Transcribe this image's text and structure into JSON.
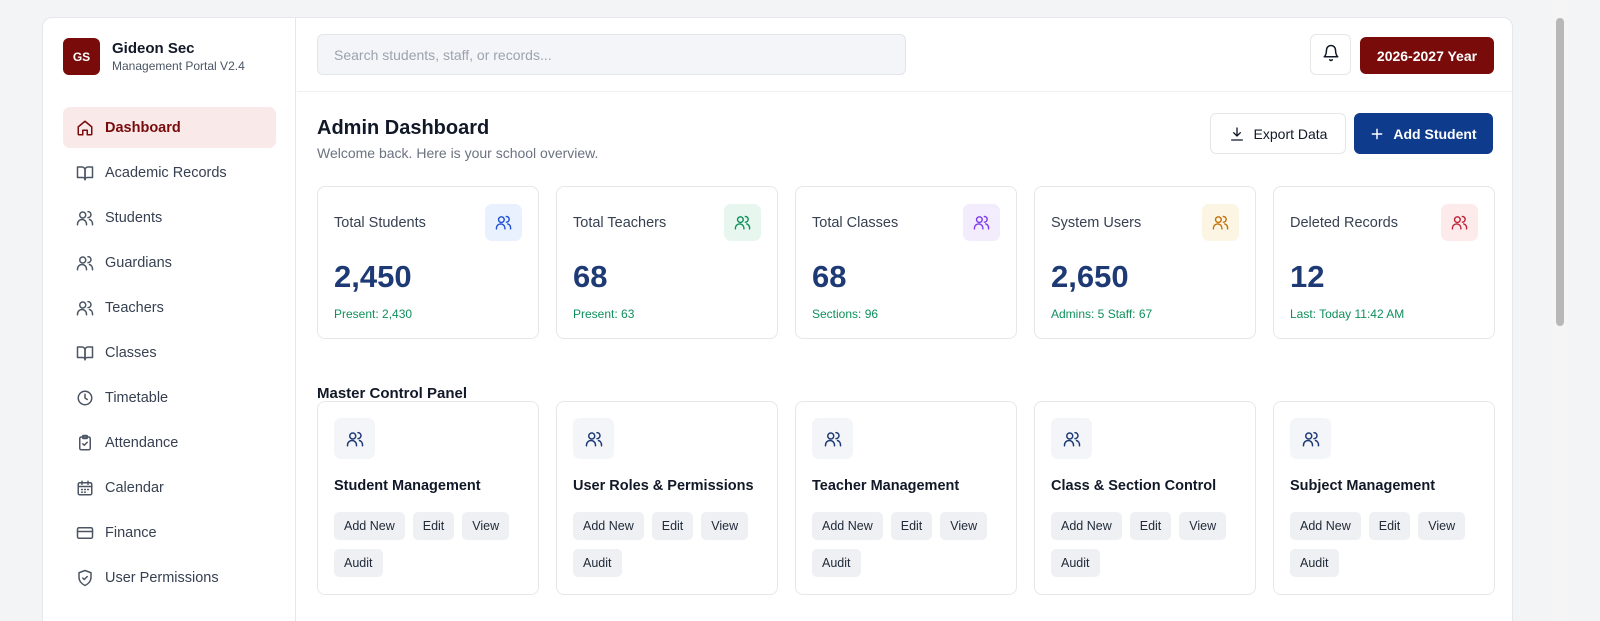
{
  "brand": {
    "logo_text": "GS",
    "name": "Gideon Sec",
    "subtitle": "Management Portal V2.4",
    "color": "#7a0b0b"
  },
  "sidebar": {
    "items": [
      {
        "label": "Dashboard",
        "icon": "home-icon",
        "active": true
      },
      {
        "label": "Academic Records",
        "icon": "book-icon"
      },
      {
        "label": "Students",
        "icon": "users-icon"
      },
      {
        "label": "Guardians",
        "icon": "users-icon"
      },
      {
        "label": "Teachers",
        "icon": "users-icon"
      },
      {
        "label": "Classes",
        "icon": "book-icon"
      },
      {
        "label": "Timetable",
        "icon": "clock-icon"
      },
      {
        "label": "Attendance",
        "icon": "clipboard-icon"
      },
      {
        "label": "Calendar",
        "icon": "calendar-icon"
      },
      {
        "label": "Finance",
        "icon": "credit-card-icon"
      },
      {
        "label": "User Permissions",
        "icon": "shield-icon"
      }
    ]
  },
  "header": {
    "search_placeholder": "Search students, staff, or records...",
    "notification_icon": "bell-icon",
    "year_label": "2026-2027 Year"
  },
  "main": {
    "title": "Admin Dashboard",
    "subtitle": "Welcome back. Here is your school overview.",
    "export_label": "Export Data",
    "add_label": "Add Student",
    "accent_color": "#0f3b8c"
  },
  "stats": [
    {
      "label": "Total Students",
      "value": "2,450",
      "sub": "Present: 2,430",
      "icon": "users-icon",
      "color": "#1d4ed8",
      "bg": "#eaf1fe"
    },
    {
      "label": "Total Teachers",
      "value": "68",
      "sub": "Present: 63",
      "icon": "users-icon",
      "color": "#0f8f5c",
      "bg": "#e7f7ef"
    },
    {
      "label": "Total Classes",
      "value": "68",
      "sub": "Sections: 96",
      "icon": "users-icon",
      "color": "#7c3aed",
      "bg": "#f2ecfd"
    },
    {
      "label": "System Users",
      "value": "2,650",
      "sub": "Admins: 5 Staff: 67",
      "icon": "users-icon",
      "color": "#c2710c",
      "bg": "#fdf5e3"
    },
    {
      "label": "Deleted Records",
      "value": "12",
      "sub": "Last: Today 11:42 AM",
      "icon": "users-icon",
      "color": "#be2337",
      "bg": "#fdebec"
    }
  ],
  "control_panel": {
    "title": "Master Control Panel",
    "cards": [
      {
        "title": "Student Management",
        "actions": [
          "Add New",
          "Edit",
          "View",
          "Audit"
        ]
      },
      {
        "title": "User Roles & Permissions",
        "actions": [
          "Add New",
          "Edit",
          "View",
          "Audit"
        ]
      },
      {
        "title": "Teacher Management",
        "actions": [
          "Add New",
          "Edit",
          "View",
          "Audit"
        ]
      },
      {
        "title": "Class & Section Control",
        "actions": [
          "Add New",
          "Edit",
          "View",
          "Audit"
        ]
      },
      {
        "title": "Subject Management",
        "actions": [
          "Add New",
          "Edit",
          "View",
          "Audit"
        ]
      }
    ]
  }
}
